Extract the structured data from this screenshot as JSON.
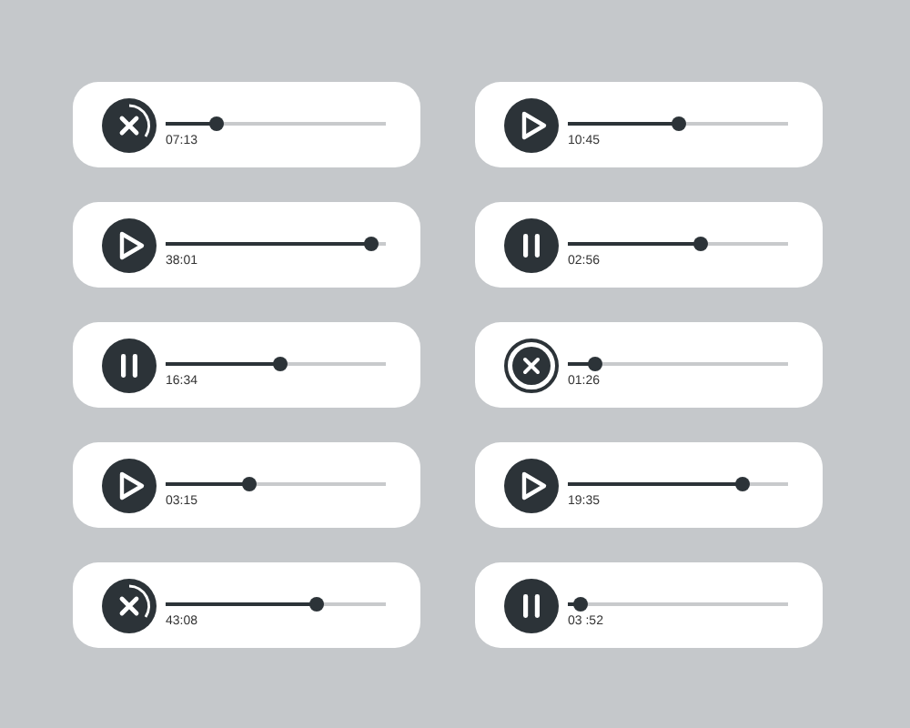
{
  "players": [
    {
      "kind": "cancel",
      "level": 0.23,
      "time": "07:13"
    },
    {
      "kind": "play",
      "level": 0.5,
      "time": "10:45"
    },
    {
      "kind": "play",
      "level": 0.93,
      "time": "38:01"
    },
    {
      "kind": "pause",
      "level": 0.6,
      "time": "02:56"
    },
    {
      "kind": "pause",
      "level": 0.52,
      "time": "16:34"
    },
    {
      "kind": "cancel-ring",
      "level": 0.12,
      "time": "01:26"
    },
    {
      "kind": "play",
      "level": 0.38,
      "time": "03:15"
    },
    {
      "kind": "play",
      "level": 0.79,
      "time": "19:35"
    },
    {
      "kind": "cancel",
      "level": 0.69,
      "time": "43:08"
    },
    {
      "kind": "pause",
      "level": 0.06,
      "time": "03 :52"
    }
  ]
}
